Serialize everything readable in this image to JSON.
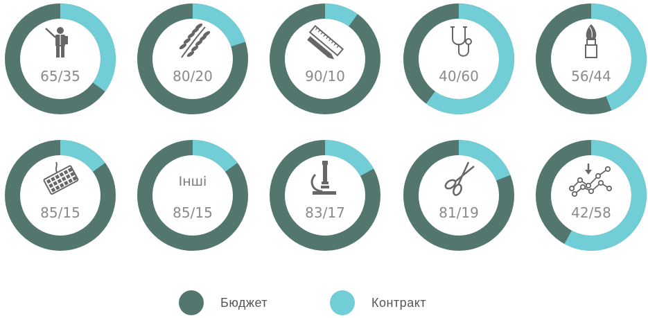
{
  "colors": {
    "budget": "#53766f",
    "contract": "#71cdd6",
    "icon": "#666666"
  },
  "chart_data": [
    {
      "type": "pie",
      "style": "donut",
      "icon": "teacher-icon",
      "label": "65/35",
      "values": [
        {
          "name": "Бюджет",
          "value": 65
        },
        {
          "name": "Контракт",
          "value": 35
        }
      ]
    },
    {
      "type": "pie",
      "style": "donut",
      "icon": "wheat-icon",
      "label": "80/20",
      "values": [
        {
          "name": "Бюджет",
          "value": 80
        },
        {
          "name": "Контракт",
          "value": 20
        }
      ]
    },
    {
      "type": "pie",
      "style": "donut",
      "icon": "ruler-pencil-icon",
      "label": "90/10",
      "values": [
        {
          "name": "Бюджет",
          "value": 90
        },
        {
          "name": "Контракт",
          "value": 10
        }
      ]
    },
    {
      "type": "pie",
      "style": "donut",
      "icon": "stethoscope-icon",
      "label": "40/60",
      "values": [
        {
          "name": "Бюджет",
          "value": 40
        },
        {
          "name": "Контракт",
          "value": 60
        }
      ]
    },
    {
      "type": "pie",
      "style": "donut",
      "icon": "paintbrush-icon",
      "label": "56/44",
      "values": [
        {
          "name": "Бюджет",
          "value": 56
        },
        {
          "name": "Контракт",
          "value": 44
        }
      ]
    },
    {
      "type": "pie",
      "style": "donut",
      "icon": "keyboard-icon",
      "label": "85/15",
      "values": [
        {
          "name": "Бюджет",
          "value": 85
        },
        {
          "name": "Контракт",
          "value": 15
        }
      ]
    },
    {
      "type": "pie",
      "style": "donut",
      "icon": "",
      "icon_text": "Інші",
      "label": "85/15",
      "values": [
        {
          "name": "Бюджет",
          "value": 85
        },
        {
          "name": "Контракт",
          "value": 15
        }
      ]
    },
    {
      "type": "pie",
      "style": "donut",
      "icon": "microscope-icon",
      "label": "83/17",
      "values": [
        {
          "name": "Бюджет",
          "value": 83
        },
        {
          "name": "Контракт",
          "value": 17
        }
      ]
    },
    {
      "type": "pie",
      "style": "donut",
      "icon": "scissors-icon",
      "label": "81/19",
      "values": [
        {
          "name": "Бюджет",
          "value": 81
        },
        {
          "name": "Контракт",
          "value": 19
        }
      ]
    },
    {
      "type": "pie",
      "style": "donut",
      "icon": "line-graph-icon",
      "label": "42/58",
      "values": [
        {
          "name": "Бюджет",
          "value": 42
        },
        {
          "name": "Контракт",
          "value": 58
        }
      ]
    }
  ],
  "legend": [
    {
      "label": "Бюджет",
      "color": "#53766f"
    },
    {
      "label": "Контракт",
      "color": "#71cdd6"
    }
  ]
}
